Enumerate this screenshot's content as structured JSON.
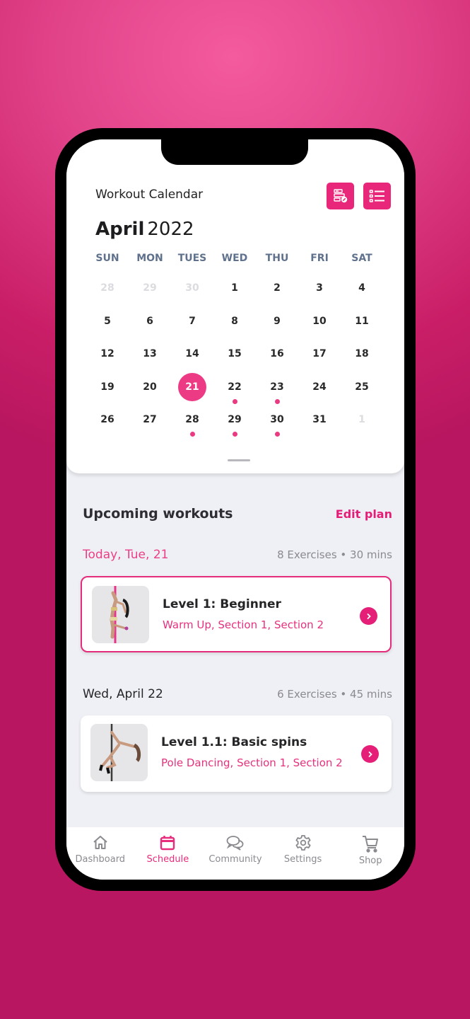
{
  "header": {
    "title": "Workout Calendar",
    "month": "April",
    "year": "2022",
    "icons": [
      "edit-schedule-icon",
      "list-view-icon"
    ]
  },
  "calendar": {
    "weekdays": [
      "SUN",
      "MON",
      "TUES",
      "WED",
      "THU",
      "FRI",
      "SAT"
    ],
    "weeks": [
      [
        {
          "d": "28",
          "muted": true
        },
        {
          "d": "29",
          "muted": true
        },
        {
          "d": "30",
          "muted": true
        },
        {
          "d": "1"
        },
        {
          "d": "2"
        },
        {
          "d": "3"
        },
        {
          "d": "4"
        }
      ],
      [
        {
          "d": "5"
        },
        {
          "d": "6"
        },
        {
          "d": "7"
        },
        {
          "d": "8"
        },
        {
          "d": "9"
        },
        {
          "d": "10"
        },
        {
          "d": "11"
        }
      ],
      [
        {
          "d": "12"
        },
        {
          "d": "13"
        },
        {
          "d": "14"
        },
        {
          "d": "15"
        },
        {
          "d": "16"
        },
        {
          "d": "17"
        },
        {
          "d": "18"
        }
      ],
      [
        {
          "d": "19"
        },
        {
          "d": "20"
        },
        {
          "d": "21",
          "selected": true
        },
        {
          "d": "22",
          "dot": true
        },
        {
          "d": "23",
          "dot": true
        },
        {
          "d": "24"
        },
        {
          "d": "25"
        }
      ],
      [
        {
          "d": "26"
        },
        {
          "d": "27"
        },
        {
          "d": "28",
          "dot": true
        },
        {
          "d": "29",
          "dot": true
        },
        {
          "d": "30",
          "dot": true
        },
        {
          "d": "31"
        },
        {
          "d": "1",
          "muted": true
        }
      ]
    ],
    "selected_day": "21"
  },
  "upcoming": {
    "title": "Upcoming workouts",
    "edit_label": "Edit plan",
    "days": [
      {
        "label": "Today, Tue, 21",
        "meta": "8 Exercises • 30 mins",
        "workout": {
          "title": "Level 1: Beginner",
          "subtitle": "Warm Up, Section 1, Section 2"
        }
      },
      {
        "label": "Wed, April 22",
        "meta": "6 Exercises • 45 mins",
        "workout": {
          "title": "Level 1.1: Basic spins",
          "subtitle": "Pole Dancing, Section 1, Section 2"
        }
      }
    ]
  },
  "tabbar": {
    "items": [
      {
        "label": "Dashboard",
        "icon": "home-icon"
      },
      {
        "label": "Schedule",
        "icon": "calendar-icon",
        "active": true
      },
      {
        "label": "Community",
        "icon": "chat-bubbles-icon"
      },
      {
        "label": "Settings",
        "icon": "gear-icon"
      },
      {
        "label": "Shop",
        "icon": "cart-icon"
      }
    ]
  },
  "colors": {
    "accent": "#e9277a",
    "selected_day": "#ec3a84",
    "weekday_text": "#5f718c",
    "muted_text": "#8a8a90",
    "screen_bg": "#eff0f5"
  }
}
